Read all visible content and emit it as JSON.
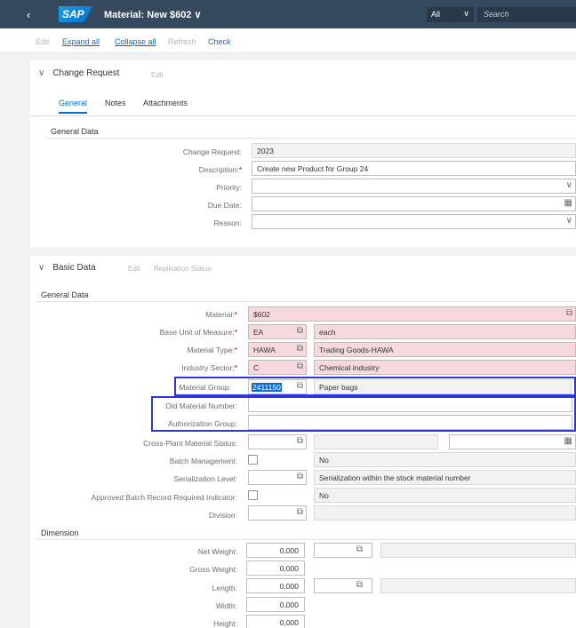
{
  "shell": {
    "back": "‹",
    "logo": "SAP",
    "title": "Material: New $602 ∨",
    "scope": "All",
    "search_placeholder": "Search"
  },
  "toolbar": {
    "edit": "Edit",
    "expand_all": "Expand all",
    "collapse_all": "Collapse all",
    "refresh": "Refresh",
    "check": "Check"
  },
  "change_request": {
    "header": "Change Request",
    "edit": "Edit",
    "tabs": [
      "General",
      "Notes",
      "Attachments"
    ],
    "section_title": "General Data",
    "fields": {
      "change_request_label": "Change Request:",
      "change_request_value": "2023",
      "description_label": "Description:",
      "description_value": "Create new Product for Group 24",
      "priority_label": "Priority:",
      "due_date_label": "Due Date:",
      "reason_label": "Reason:"
    }
  },
  "basic_data": {
    "header": "Basic Data",
    "edit": "Edit",
    "replication_status": "Replication Status",
    "section_title": "General Data",
    "fields": {
      "material_label": "Material:",
      "material_value": "$602",
      "base_uom_label": "Base Unit of Measure:",
      "base_uom_value": "EA",
      "base_uom_desc": "each",
      "material_type_label": "Material Type:",
      "material_type_value": "HAWA",
      "material_type_desc": "Trading Goods-HAWA",
      "industry_label": "Industry Sector:",
      "industry_value": "C",
      "industry_desc": "Chemical industry",
      "material_group_label": "Material Group:",
      "material_group_value": "2411150",
      "material_group_desc": "Paper bags",
      "old_material_label": "Old Material Number:",
      "auth_group_label": "Authorization Group:",
      "cross_plant_label": "Cross-Plant Material Status:",
      "batch_label": "Batch Management:",
      "batch_value": "No",
      "serial_label": "Serialization Level:",
      "serial_value": "Serialization within the stock material number",
      "approved_label": "Approved Batch Record Required Indicator:",
      "approved_value": "No",
      "division_label": "Division:"
    }
  },
  "dimension": {
    "title": "Dimension",
    "net_weight_label": "Net Weight:",
    "net_weight_value": "0,000",
    "gross_weight_label": "Gross Weight:",
    "gross_weight_value": "0,000",
    "length_label": "Length:",
    "length_value": "0,000",
    "width_label": "Width:",
    "width_value": "0,000",
    "height_label": "Height:",
    "height_value": "0,000"
  },
  "colors": {
    "shell_bg": "#354a5f",
    "link": "#0a6ed1",
    "required": "#bb0000",
    "highlight_field": "#f5d9dc",
    "annotation_box": "#2c35e0"
  }
}
